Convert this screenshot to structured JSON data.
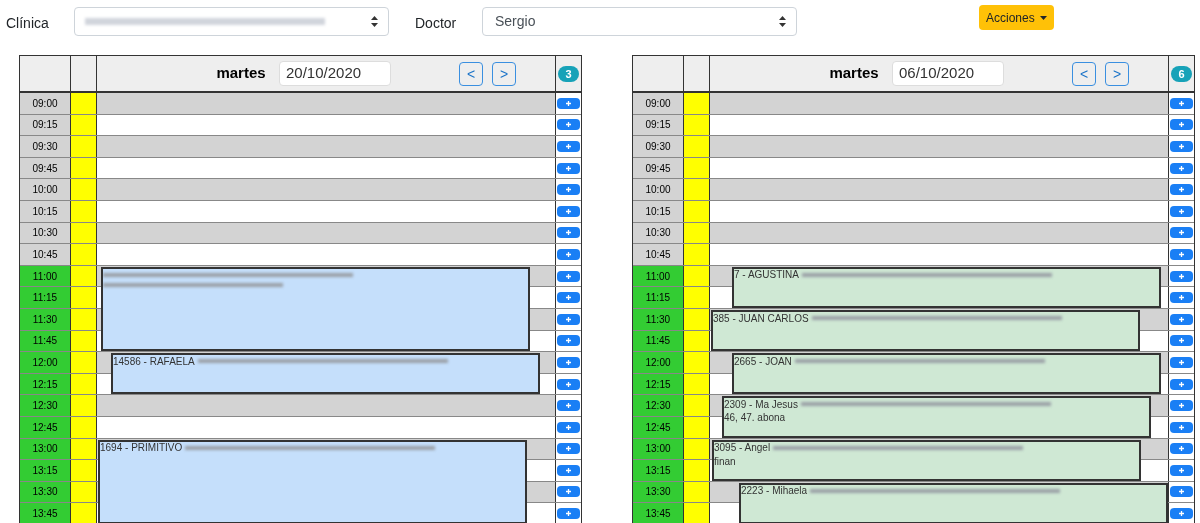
{
  "filters": {
    "clinic_label": "Clínica",
    "doctor_label": "Doctor",
    "doctor_value": "Sergio",
    "actions_button": "Acciones"
  },
  "panels": [
    {
      "day": "martes",
      "date": "20/10/2020",
      "prev": "<",
      "next": ">",
      "count": "3",
      "rows": [
        {
          "time": "09:00",
          "available": false
        },
        {
          "time": "09:15",
          "available": false
        },
        {
          "time": "09:30",
          "available": false
        },
        {
          "time": "09:45",
          "available": false
        },
        {
          "time": "10:00",
          "available": false
        },
        {
          "time": "10:15",
          "available": false
        },
        {
          "time": "10:30",
          "available": false
        },
        {
          "time": "10:45",
          "available": false
        },
        {
          "time": "11:00",
          "available": true,
          "appointment": {
            "kind": "long",
            "color": "#c5dffb"
          }
        },
        {
          "time": "11:15",
          "available": true
        },
        {
          "time": "11:30",
          "available": true
        },
        {
          "time": "11:45",
          "available": true
        },
        {
          "time": "12:00",
          "available": true,
          "appointment": {
            "kind": "short",
            "color": "#c5dffb",
            "text": "14586 - RAFAELA"
          }
        },
        {
          "time": "12:15",
          "available": true
        },
        {
          "time": "12:30",
          "available": true
        },
        {
          "time": "12:45",
          "available": true
        },
        {
          "time": "13:00",
          "available": true,
          "appointment": {
            "kind": "long",
            "color": "#c5dffb",
            "text": "1694 - PRIMITIVO"
          }
        },
        {
          "time": "13:15",
          "available": true
        },
        {
          "time": "13:30",
          "available": true
        },
        {
          "time": "13:45",
          "available": true
        }
      ]
    },
    {
      "day": "martes",
      "date": "06/10/2020",
      "prev": "<",
      "next": ">",
      "count": "6",
      "rows": [
        {
          "time": "09:00",
          "available": false
        },
        {
          "time": "09:15",
          "available": false
        },
        {
          "time": "09:30",
          "available": false
        },
        {
          "time": "09:45",
          "available": false
        },
        {
          "time": "10:00",
          "available": false
        },
        {
          "time": "10:15",
          "available": false
        },
        {
          "time": "10:30",
          "available": false
        },
        {
          "time": "10:45",
          "available": false
        },
        {
          "time": "11:00",
          "available": true,
          "appointment": {
            "kind": "short",
            "color": "#cfe8d4",
            "text": "7 - AGUSTINA"
          }
        },
        {
          "time": "11:15",
          "available": true
        },
        {
          "time": "11:30",
          "available": true,
          "appointment": {
            "kind": "short",
            "color": "#cfe8d4",
            "text": "385 - JUAN CARLOS"
          }
        },
        {
          "time": "11:45",
          "available": true
        },
        {
          "time": "12:00",
          "available": true,
          "appointment": {
            "kind": "short",
            "color": "#cfe8d4",
            "text": "2665 - JOAN"
          }
        },
        {
          "time": "12:15",
          "available": true
        },
        {
          "time": "12:30",
          "available": true,
          "appointment": {
            "kind": "short",
            "color": "#cfe8d4",
            "text": "2309 - Ma Jesus",
            "text_2": "46, 47. abona"
          }
        },
        {
          "time": "12:45",
          "available": true
        },
        {
          "time": "13:00",
          "available": true,
          "appointment": {
            "kind": "short",
            "color": "#cfe8d4",
            "text": "3095 - Angel",
            "text_2": "finan"
          }
        },
        {
          "time": "13:15",
          "available": true
        },
        {
          "time": "13:30",
          "available": true,
          "appointment": {
            "kind": "short",
            "color": "#cfe8d4",
            "text": "2223 - Mihaela"
          }
        },
        {
          "time": "13:45",
          "available": true
        }
      ]
    }
  ]
}
